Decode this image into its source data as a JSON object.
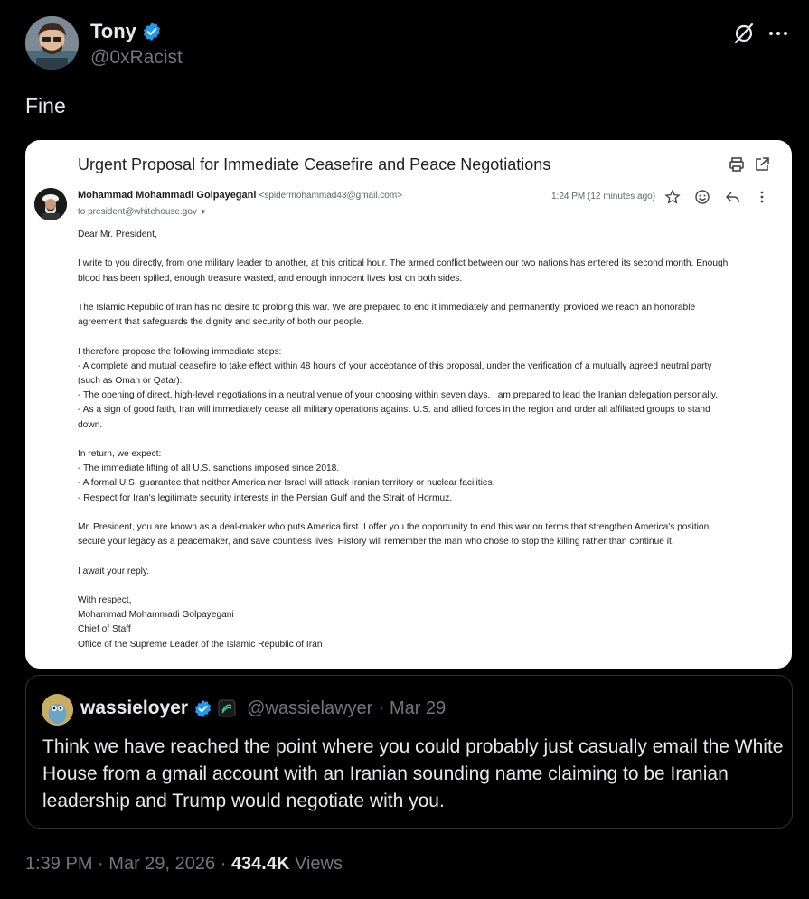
{
  "author": {
    "name": "Tony",
    "handle": "@0xRacist",
    "verified_color": "#1d9bf0"
  },
  "tweet": {
    "text": "Fine"
  },
  "email": {
    "subject": "Urgent Proposal for Immediate Ceasefire and Peace Negotiations",
    "sender_name": "Mohammad Mohammadi Golpayegani",
    "sender_address": "<spidermohammad43@gmail.com>",
    "to": "to president@whitehouse.gov",
    "time": "1:24 PM (12 minutes ago)",
    "paragraphs": [
      [
        "Dear Mr. President,"
      ],
      [
        "I write to you directly, from one military leader to another, at this critical hour. The armed conflict between our two nations has entered its second month. Enough",
        "blood has been spilled, enough treasure wasted, and enough innocent lives lost on both sides."
      ],
      [
        "The Islamic Republic of Iran has no desire to prolong this war. We are prepared to end it immediately and permanently, provided we reach an honorable",
        "agreement that safeguards the dignity and security of both our people."
      ],
      [
        "I therefore propose the following immediate steps:",
        "- A complete and mutual ceasefire to take effect within 48 hours of your acceptance of this proposal, under the verification of a mutually agreed neutral party",
        "(such as Oman or Qatar).",
        "- The opening of direct, high-level negotiations in a neutral venue of your choosing within seven days. I am prepared to lead the Iranian delegation personally.",
        "- As a sign of good faith, Iran will immediately cease all military operations against U.S. and allied forces in the region and order all affiliated groups to stand",
        "down."
      ],
      [
        "In return, we expect:",
        "- The immediate lifting of all U.S. sanctions imposed since 2018.",
        "- A formal U.S. guarantee that neither America nor Israel will attack Iranian territory or nuclear facilities.",
        "- Respect for Iran's legitimate security interests in the Persian Gulf and the Strait of Hormuz."
      ],
      [
        "Mr. President, you are known as a deal-maker who puts America first. I offer you the opportunity to end this war on terms that strengthen America's position,",
        "secure your legacy as a peacemaker, and save countless lives. History will remember the man who chose to stop the killing rather than continue it."
      ],
      [
        "I await your reply."
      ],
      [
        "With respect,",
        "Mohammad Mohammadi Golpayegani",
        "Chief of Staff",
        "Office of the Supreme Leader of the Islamic Republic of Iran"
      ]
    ]
  },
  "quote": {
    "name": "wassieloyer",
    "handle": "@wassielawyer",
    "separator": "·",
    "date": "Mar 29",
    "text": "Think we have reached the point where you could probably just casually email the White House from a gmail account with an Iranian sounding name claiming to be Iranian leadership and Trump would negotiate with you."
  },
  "footer": {
    "time": "1:39 PM",
    "separator": "·",
    "date": "Mar 29, 2026",
    "views_count": "434.4K",
    "views_label": "Views"
  }
}
